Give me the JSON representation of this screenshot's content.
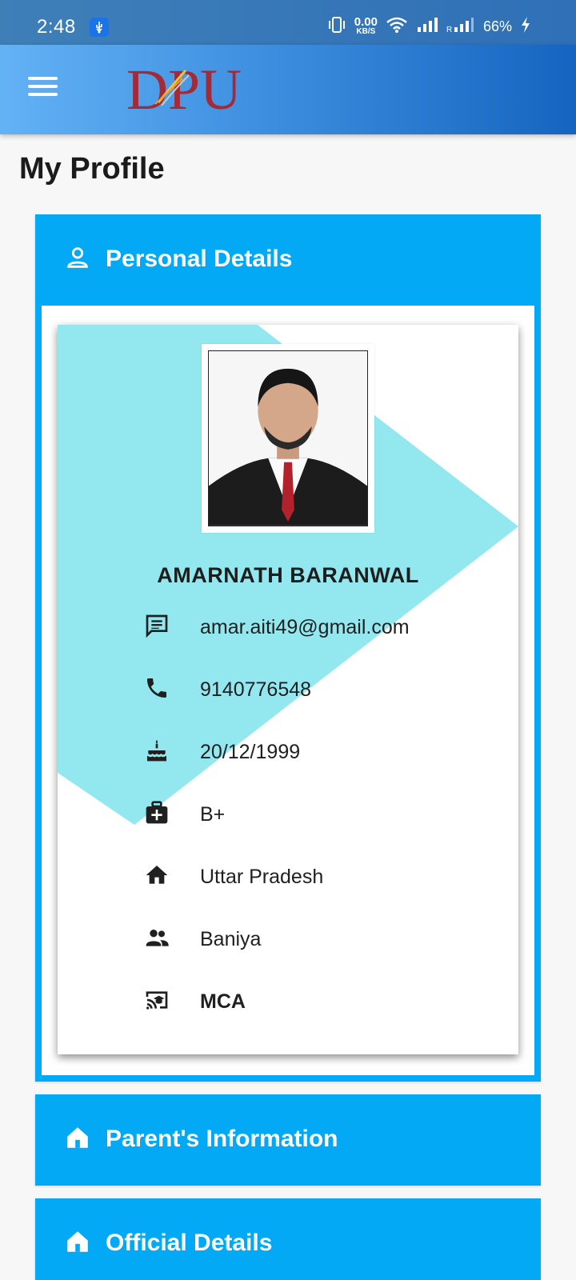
{
  "status_bar": {
    "time": "2:48",
    "speed_value": "0.00",
    "speed_unit": "KB/S",
    "battery": "66%"
  },
  "app_bar": {
    "logo_text": "DPU",
    "menu_icon": "menu-icon"
  },
  "page": {
    "title": "My Profile"
  },
  "sections": {
    "personal": {
      "title": "Personal Details",
      "icon": "person-icon"
    },
    "parents": {
      "title": "Parent's Information",
      "icon": "home-icon"
    },
    "official": {
      "title": "Official Details",
      "icon": "home-icon"
    }
  },
  "profile": {
    "name": "AMARNATH BARANWAL",
    "email": "amar.aiti49@gmail.com",
    "phone": "9140776548",
    "dob": "20/12/1999",
    "blood_group": "B+",
    "state": "Uttar Pradesh",
    "caste": "Baniya",
    "course": "MCA"
  },
  "colors": {
    "section_blue": "#03a9f4",
    "card_accent": "#93e8f0",
    "appbar_start": "#63b2f6",
    "appbar_end": "#1565c0"
  }
}
